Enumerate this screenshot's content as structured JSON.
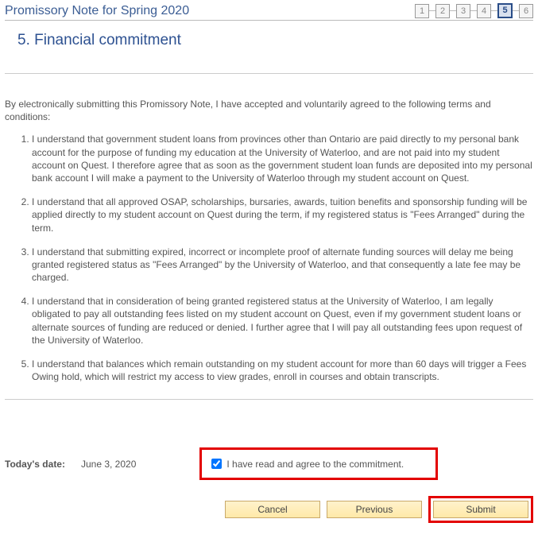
{
  "header": {
    "title": "Promissory Note for Spring 2020",
    "steps": [
      "1",
      "2",
      "3",
      "4",
      "5",
      "6"
    ],
    "active_step_index": 4
  },
  "section": {
    "heading": "5. Financial commitment"
  },
  "intro": "By electronically submitting this Promissory Note, I have accepted and voluntarily agreed to the following terms and conditions:",
  "terms": [
    "I understand that government student loans from provinces other than Ontario are paid directly to my personal bank account for the purpose of funding my education at the University of Waterloo, and are not paid into my student account on Quest. I therefore agree that as soon as the government student loan funds are deposited into my personal bank account I will make a payment to the University of Waterloo through my student account on Quest.",
    "I understand that all approved OSAP, scholarships, bursaries, awards, tuition benefits and sponsorship funding will be applied directly to my student account on Quest during the term, if my registered status is \"Fees Arranged\" during the term.",
    "I understand that submitting expired, incorrect or incomplete proof of alternate funding sources will delay me being granted registered status as \"Fees Arranged\" by the University of Waterloo, and that consequently a late fee may be charged.",
    "I understand that in consideration of being granted registered status at the University of Waterloo, I am legally obligated to pay all outstanding fees listed on my student account on Quest, even if my government student loans or alternate sources of funding are reduced or denied. I further agree that I will pay all outstanding fees upon request of the University of Waterloo.",
    "I understand that balances which remain outstanding on my student account for more than 60 days will trigger a Fees Owing hold, which will restrict my access to view grades, enroll in courses and obtain transcripts."
  ],
  "footer": {
    "date_label": "Today's date:",
    "date_value": "June 3, 2020",
    "agree_label": "I have read and agree to the commitment.",
    "agree_checked": true,
    "buttons": {
      "cancel": "Cancel",
      "previous": "Previous",
      "submit": "Submit"
    }
  }
}
